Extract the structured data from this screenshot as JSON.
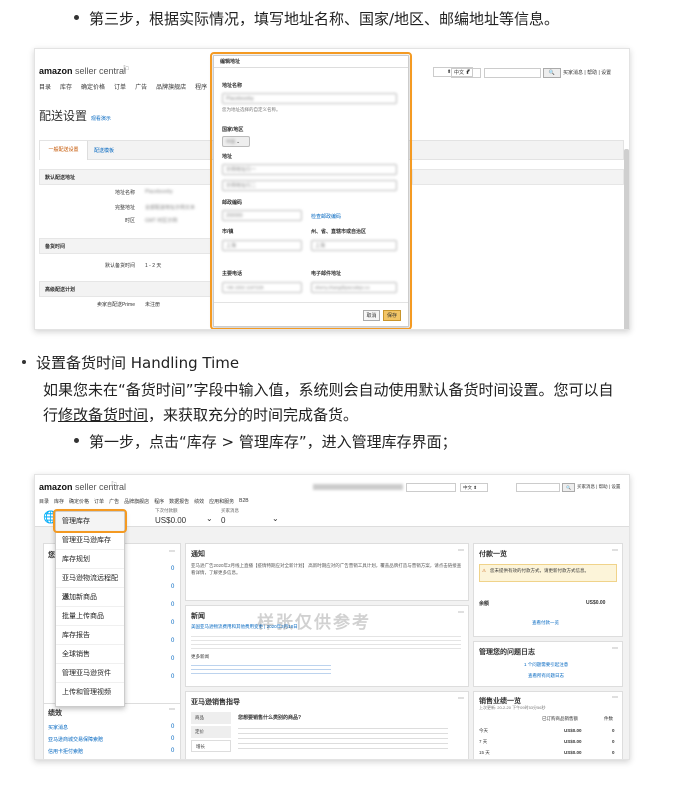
{
  "instructions": {
    "step3": "第三步，根据实际情况，填写地址名称、国家/地区、邮编地址等信息。",
    "handling_title": "设置备货时间 Handling Time",
    "handling_desc1": "如果您未在“备货时间”字段中输入值，系统则会自动使用默认备货时间设置。您可以自",
    "handling_desc2_prefix": "行",
    "handling_desc2_link": "修改备货时间",
    "handling_desc2_suffix": "，来获取充分的时间完成备货。",
    "step1": "第一步，点击“库存 > 管理库存”，进入管理库存界面；"
  },
  "shot1": {
    "logo_main": "amazon",
    "logo_sub": "seller central",
    "nav": [
      "目录",
      "库存",
      "确定价格",
      "订单",
      "广告",
      "品牌旗舰店",
      "程序"
    ],
    "lang": "中文",
    "search_btn": "搜索",
    "top_links": "买家消息 | 帮助 | 设置",
    "page_title": "配送设置",
    "page_title_link": "观看演示",
    "tabs": [
      "一般配送设置",
      "配送模板"
    ],
    "section_default_addr": "默认配送地址",
    "addr_rows": [
      {
        "label": "地址名称",
        "value": "Placeboorby"
      },
      {
        "label": "完整地址",
        "value": "全部配送地址示例文本"
      },
      {
        "label": "时区",
        "value": "GMT 时区示例"
      }
    ],
    "section_handling": "备货时间",
    "handling_label": "默认备货时间",
    "handling_value": "1 - 2 天",
    "section_advanced": "高级配送计划",
    "prime_label": "卖家自配送Prime",
    "prime_value": "未注册",
    "dialog": {
      "title": "编辑地址",
      "name_label": "地址名称",
      "name_value": "Placeboorby",
      "name_hint": "您为地址选择的自定义名称。",
      "country_label": "国家/地区",
      "country_value": "中国",
      "address_label": "地址",
      "address_value1": "示例地址行一",
      "address_value2": "示例地址行二",
      "zip_label": "邮政编码",
      "zip_value": "200000",
      "zip_link": "检查邮政编码",
      "city_label": "市/镇",
      "city_value": "上海",
      "state_label": "州、省、直辖市或自治区",
      "state_value": "上海",
      "phone_label": "主要电话",
      "phone_value": "+86 1502 1197228",
      "email_label": "电子邮件地址",
      "email_value": "sherry.zhang@pacodejo.co",
      "cancel": "取消",
      "save": "保存"
    }
  },
  "shot2": {
    "logo_main": "amazon",
    "logo_sub": "seller central",
    "nav": [
      "目录",
      "库存",
      "确定价格",
      "订单",
      "广告",
      "品牌旗舰店",
      "程序",
      "数据报告",
      "绩效",
      "应用和服务",
      "B2B"
    ],
    "lang": "中文",
    "search_btn": "搜索",
    "top_links": "买家消息 | 帮助 | 设置",
    "stat1_label": "下次付款额",
    "stat1_value": "US$0.00",
    "stat2_label": "买家消息",
    "stat2_value": "0",
    "inventory_menu": [
      "管理库存",
      "管理亚马逊库存",
      "库存规划",
      "亚马逊物流远程配送",
      "添加新商品",
      "批量上传商品",
      "库存报告",
      "全球销售",
      "管理亚马逊货件",
      "上传和管理视频"
    ],
    "notice_title": "通知",
    "notice_text": "亚马逊广告2020年2月线上直播【疫情特期应对全新计划】 高新时期应对的广告营销工具计划，覆盖品牌打造与营销方案，请点击链接查看详情，了解更多信息。",
    "news_title": "新闻",
    "news_text1": "美国亚马逊物流费用和其他费用变更 | 2020年3月18日",
    "news_text2": "更多新闻",
    "fba_title": "亚马逊销售指导",
    "fba_question": "您想要销售什么类别的商品?",
    "fba_tabs": [
      "商品",
      "定价",
      "增长"
    ],
    "payment_title": "付款一览",
    "payment_note": "您未提供有效的付款方式，请更新付款方式信息。",
    "payment_total_label": "余额",
    "payment_total_value": "US$0.00",
    "payment_link": "查看付款一览",
    "issue_title": "管理您的问题日志",
    "issue_link1": "1 个问题需要引起注意",
    "issue_link2": "查看所有问题日志",
    "sales_title": "销售业绩一览",
    "sales_sub": "上次更新: 20-2-20 下午09时53分56秒",
    "sales_head1": "已订购商品销售额",
    "sales_head2": "件数",
    "sales_rows": [
      {
        "period": "今天",
        "amount": "US$0.00",
        "units": "0"
      },
      {
        "period": "7 天",
        "amount": "US$0.00",
        "units": "0"
      },
      {
        "period": "15 天",
        "amount": "US$0.00",
        "units": "0"
      }
    ],
    "left_panel_title": "您的订单",
    "left_panel_title2": "绩效",
    "left_links": [
      "买家消息",
      "亚马逊商城交易保障索赔",
      "信用卡拒付索赔"
    ],
    "watermark": "样张仅供参考"
  },
  "colors": {
    "highlight": "#f49a22",
    "link": "#0066c0",
    "save_button": "#f3c566"
  }
}
